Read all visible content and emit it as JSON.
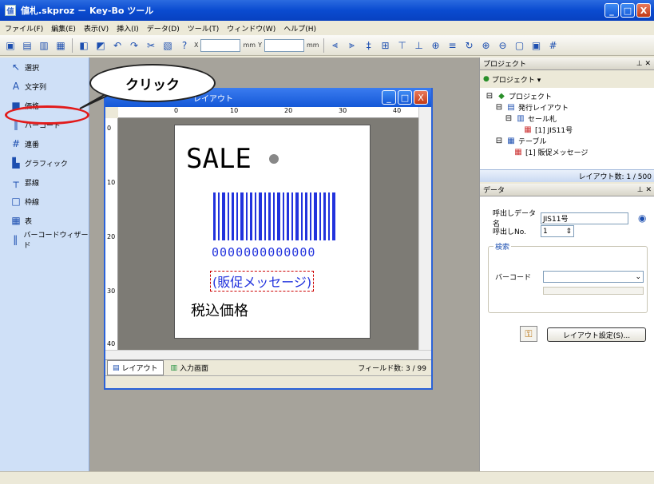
{
  "window": {
    "title": "値札.skproz － Key-Bo ツール",
    "min": "_",
    "max": "□",
    "close": "X"
  },
  "menu": [
    "ファイル(F)",
    "編集(E)",
    "表示(V)",
    "挿入(I)",
    "データ(D)",
    "ツール(T)",
    "ウィンドウ(W)",
    "ヘルプ(H)"
  ],
  "toolbar": {
    "x_label": "X",
    "y_label": "Y",
    "mm1": "mm",
    "mm2": "mm"
  },
  "tools": [
    {
      "label": "選択",
      "icon": "select-arrow-icon"
    },
    {
      "label": "文字列",
      "icon": "text-tool-icon"
    },
    {
      "label": "価格",
      "icon": "price-tool-icon"
    },
    {
      "label": "バーコード",
      "icon": "barcode-tool-icon"
    },
    {
      "label": "連番",
      "icon": "serial-number-icon"
    },
    {
      "label": "グラフィック",
      "icon": "graphic-tool-icon"
    },
    {
      "label": "罫線",
      "icon": "line-tool-icon"
    },
    {
      "label": "枠線",
      "icon": "frame-tool-icon"
    },
    {
      "label": "表",
      "icon": "table-tool-icon"
    },
    {
      "label": "バーコードウィザード",
      "icon": "barcode-wizard-icon"
    }
  ],
  "callout": {
    "text": "クリック"
  },
  "layout_window": {
    "title": "レイアウト",
    "ruler_top": [
      "0",
      "10",
      "20",
      "30",
      "40"
    ],
    "ruler_left": [
      "0",
      "10",
      "20",
      "30",
      "40"
    ],
    "label": {
      "sale": "SALE",
      "barcode_digits": "0000000000000",
      "promo": "(販促メッセージ)",
      "tax": "税込価格"
    },
    "tabs": [
      {
        "label": "レイアウト",
        "active": true
      },
      {
        "label": "入力画面",
        "active": false
      }
    ],
    "field_count": "フィールド数: 3 / 99"
  },
  "project_panel": {
    "header": "プロジェクト",
    "dropdown": "プロジェクト ▾",
    "tree": [
      {
        "label": "プロジェクト",
        "level": 0
      },
      {
        "label": "発行レイアウト",
        "level": 1
      },
      {
        "label": "セール札",
        "level": 2
      },
      {
        "label": "[1] JIS11号",
        "level": 3
      },
      {
        "label": "テーブル",
        "level": 1
      },
      {
        "label": "[1] 販促メッセージ",
        "level": 2
      }
    ],
    "layout_count": "レイアウト数: 1 / 500"
  },
  "data_panel": {
    "header": "データ",
    "call_name_label": "呼出しデータ名",
    "call_name_value": "JIS11号",
    "call_no_label": "呼出しNo.",
    "call_no_value": "1",
    "search_group": "検索",
    "barcode_label": "バーコード",
    "layout_settings_button": "レイアウト設定(S)..."
  }
}
